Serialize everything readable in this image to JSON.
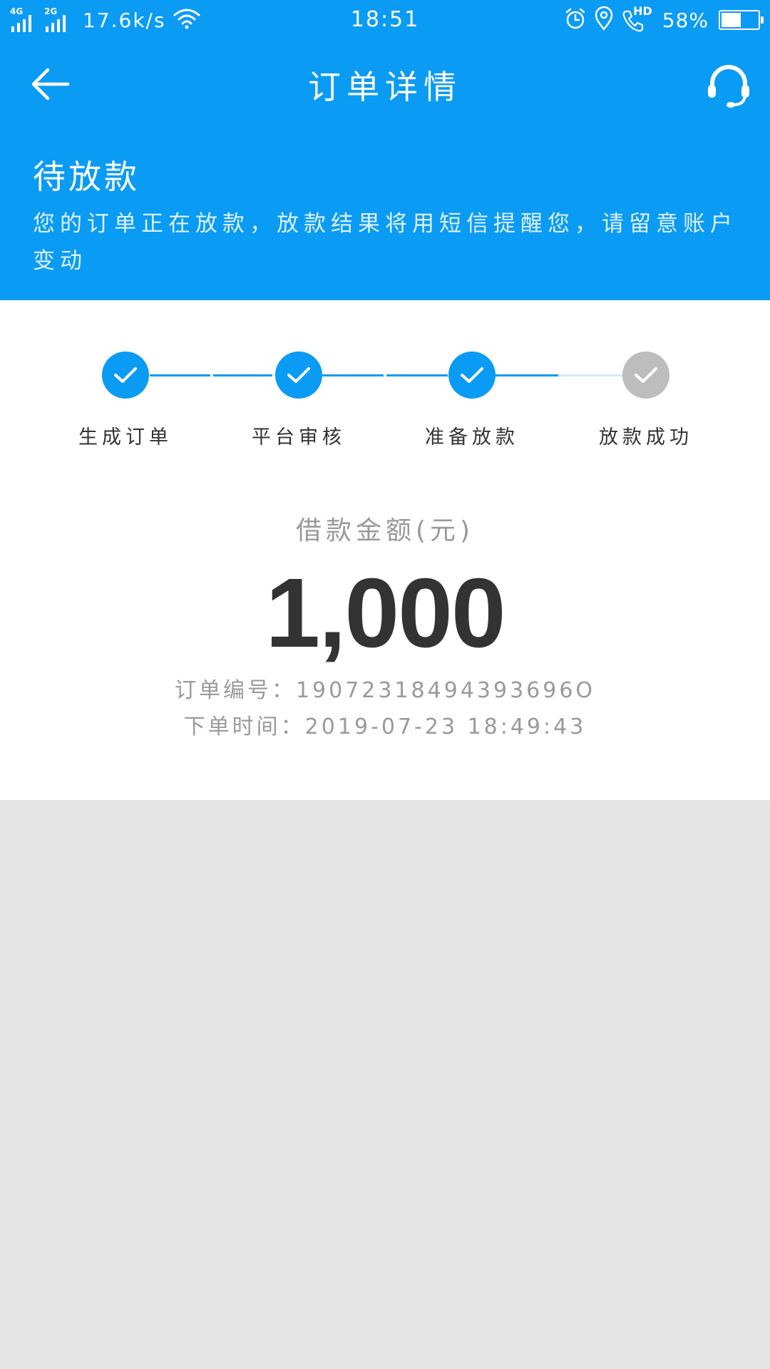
{
  "status_bar": {
    "signal_1_tag": "4G",
    "signal_2_tag": "2G",
    "net_speed": "17.6k/s",
    "time": "18:51",
    "hd_tag": "HD",
    "battery_percent_text": "58%",
    "battery_level": 0.58,
    "icons": [
      "signal-icon",
      "wifi-icon",
      "alarm-icon",
      "location-icon",
      "hd-call-icon",
      "battery-icon"
    ]
  },
  "nav": {
    "back_icon": "back-arrow-icon",
    "title": "订单详情",
    "support_icon": "headset-icon"
  },
  "order_status": {
    "title": "待放款",
    "description": "您的订单正在放款，放款结果将用短信提醒您，请留意账户变动"
  },
  "progress": {
    "steps": [
      {
        "label": "生成订单",
        "done": true
      },
      {
        "label": "平台审核",
        "done": true
      },
      {
        "label": "准备放款",
        "done": true
      },
      {
        "label": "放款成功",
        "done": false
      }
    ]
  },
  "loan": {
    "amount_label": "借款金额(元)",
    "amount": "1,000"
  },
  "order_info": {
    "number_text": "订单编号：19072318494393696O",
    "time_text": "下单时间：2019-07-23 18:49:43"
  },
  "colors": {
    "brand_blue": "#0a9bf4",
    "step_inactive": "#bdbdbd",
    "page_bg": "#e5e5e6",
    "card_bg": "#ffffff"
  }
}
